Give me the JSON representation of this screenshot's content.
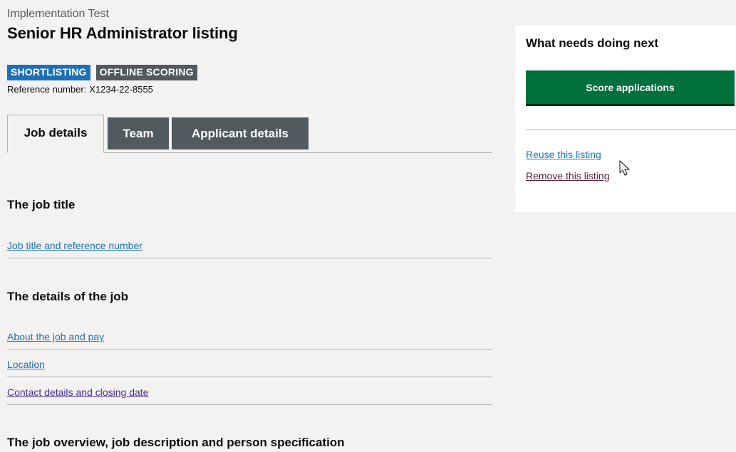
{
  "header": {
    "caption": "Implementation Test",
    "title": "Senior HR Administrator listing",
    "tags": [
      "SHORTLISTING",
      "OFFLINE SCORING"
    ],
    "reference_label": "Reference number:",
    "reference_value": "X1234-22-8555"
  },
  "tabs": [
    {
      "label": "Job details",
      "active": true
    },
    {
      "label": "Team",
      "active": false
    },
    {
      "label": "Applicant details",
      "active": false
    }
  ],
  "sections": [
    {
      "heading": "The job title",
      "links": [
        "Job title and reference number"
      ]
    },
    {
      "heading": "The details of the job",
      "links": [
        "About the job and pay",
        "Location",
        "Contact details and closing date"
      ]
    },
    {
      "heading": "The job overview, job description and person specification",
      "links": []
    }
  ],
  "sidebar": {
    "heading": "What needs doing next",
    "primary_button": "Score applications",
    "reuse_link": "Reuse this listing",
    "remove_link": "Remove this listing"
  },
  "colors": {
    "background": "#f3f2f1",
    "link": "#1d70b8",
    "visited_link": "#4c2c92",
    "primary_button": "#00703c",
    "tag_blue": "#1d70b8",
    "tag_grey": "#505a5f"
  }
}
